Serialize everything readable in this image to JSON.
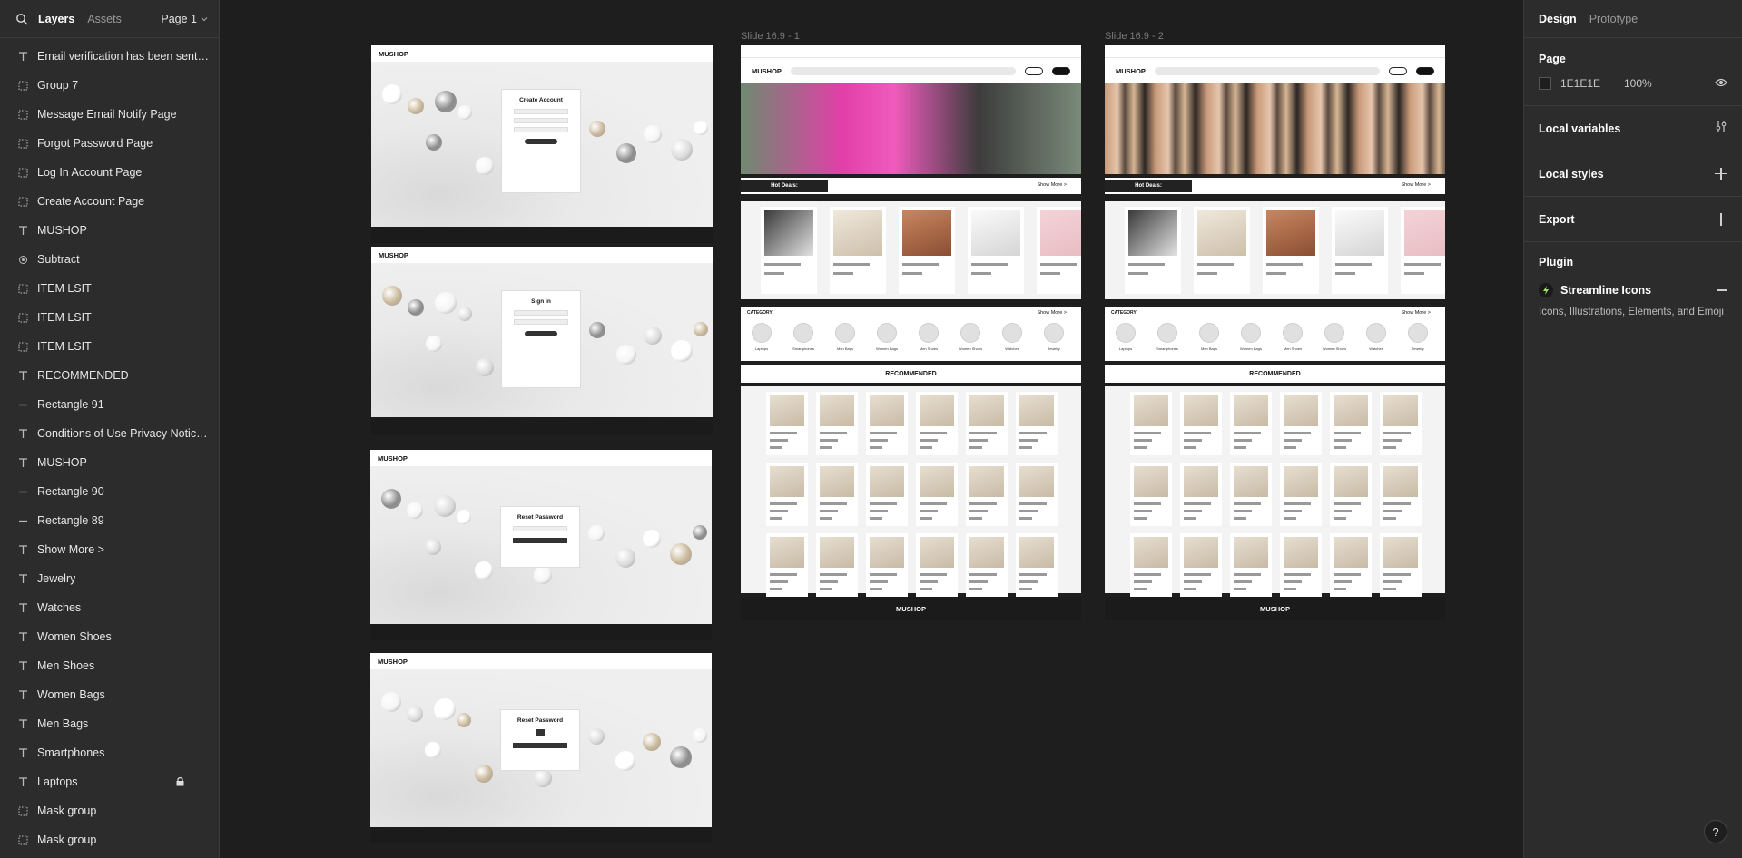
{
  "left_panel": {
    "tabs": [
      "Layers",
      "Assets"
    ],
    "page_selector": "Page 1",
    "layers": [
      {
        "type": "text",
        "label": "Email verification has been sent to..."
      },
      {
        "type": "frame",
        "label": "Group 7"
      },
      {
        "type": "frame",
        "label": "Message Email Notify Page"
      },
      {
        "type": "frame",
        "label": "Forgot Password Page"
      },
      {
        "type": "frame",
        "label": "Log In Account Page"
      },
      {
        "type": "frame",
        "label": "Create Account Page"
      },
      {
        "type": "text",
        "label": "MUSHOP"
      },
      {
        "type": "component",
        "label": "Subtract"
      },
      {
        "type": "frame",
        "label": "ITEM LSIT"
      },
      {
        "type": "frame",
        "label": "ITEM LSIT"
      },
      {
        "type": "frame",
        "label": "ITEM LSIT"
      },
      {
        "type": "text",
        "label": "RECOMMENDED"
      },
      {
        "type": "line",
        "label": "Rectangle 91"
      },
      {
        "type": "text",
        "label": "Conditions of Use Privacy Notice I..."
      },
      {
        "type": "text",
        "label": "MUSHOP"
      },
      {
        "type": "line",
        "label": "Rectangle 90"
      },
      {
        "type": "line",
        "label": "Rectangle 89"
      },
      {
        "type": "text",
        "label": "Show More >"
      },
      {
        "type": "text",
        "label": "Jewelry"
      },
      {
        "type": "text",
        "label": "Watches"
      },
      {
        "type": "text",
        "label": "Women Shoes"
      },
      {
        "type": "text",
        "label": "Men Shoes"
      },
      {
        "type": "text",
        "label": "Women Bags"
      },
      {
        "type": "text",
        "label": "Men Bags"
      },
      {
        "type": "text",
        "label": "Smartphones"
      },
      {
        "type": "text",
        "label": "Laptops",
        "locked": true
      },
      {
        "type": "frame",
        "label": "Mask group"
      },
      {
        "type": "frame",
        "label": "Mask group"
      }
    ]
  },
  "right_panel": {
    "tabs": [
      "Design",
      "Prototype"
    ],
    "page_section": {
      "title": "Page",
      "color_hex": "1E1E1E",
      "opacity": "100%"
    },
    "sections": [
      "Local variables",
      "Local styles",
      "Export"
    ],
    "plugin": {
      "title": "Plugin",
      "name": "Streamline Icons",
      "description": "Icons, Illustrations, Elements, and Emoji"
    },
    "help": "?"
  },
  "canvas": {
    "slide_labels": [
      "Slide 16:9 - 1",
      "Slide 16:9 - 2"
    ],
    "brand": "MUSHOP",
    "auth_titles": [
      "Create Account",
      "Sign in",
      "Reset Password",
      "Reset Password"
    ],
    "hot_deals": "Hot Deals:",
    "show_more": "Show More >",
    "category": "CATEGORY",
    "recommended": "RECOMMENDED",
    "categories": [
      "Laptops",
      "Smartphones",
      "Men Bags",
      "Women Bags",
      "Men Shoes",
      "Women Shoes",
      "Watches",
      "Jewelry"
    ]
  },
  "colors": {
    "canvas": "#1e1e1e",
    "panel": "#2c2c2c"
  }
}
